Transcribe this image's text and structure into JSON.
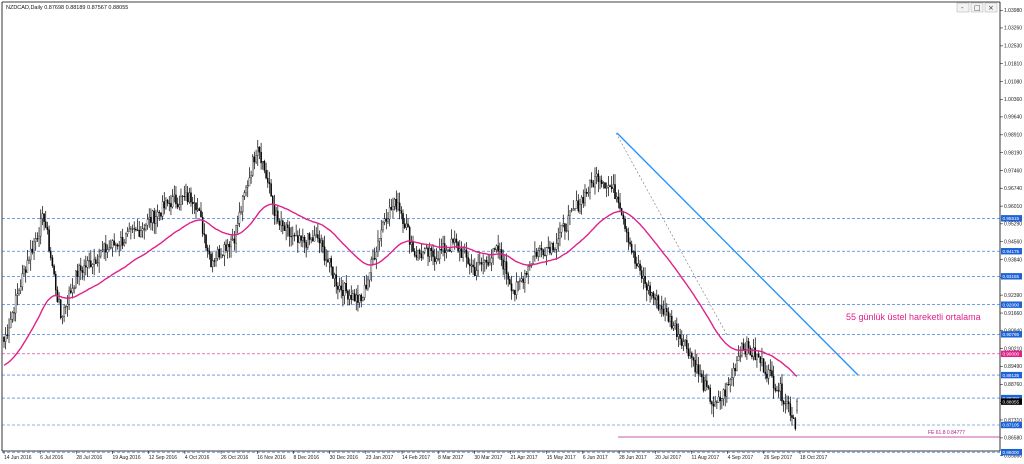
{
  "window": {
    "header_text": "NZDCAD,Daily  0.87698 0.88189 0.87567 0.88055",
    "buttons": [
      "-",
      "□",
      "×"
    ]
  },
  "chart_data": {
    "type": "candlestick",
    "symbol": "NZDCAD",
    "timeframe": "Daily",
    "ohlc": {
      "open": 0.87698,
      "high": 0.88189,
      "low": 0.87567,
      "close": 0.88055
    },
    "ylim": [
      0.8621,
      1.0399
    ],
    "price_ticks": [
      1.0398,
      1.0326,
      1.0253,
      1.0181,
      1.0108,
      1.0036,
      0.9964,
      0.9891,
      0.9819,
      0.9746,
      0.9674,
      0.9601,
      0.9529,
      0.9456,
      0.9384,
      0.9311,
      0.9239,
      0.9166,
      0.9094,
      0.9021,
      0.8949,
      0.8876,
      0.8803,
      0.8731,
      0.8658,
      0.8586
    ],
    "price_tick_labels": [
      "1.03980",
      "1.03260",
      "1.02530",
      "1.01810",
      "1.01080",
      "1.00360",
      "0.99640",
      "0.98910",
      "0.98190",
      "0.97460",
      "0.96740",
      "0.96010",
      "0.95290",
      "0.94560",
      "0.93840",
      "0.93110",
      "0.92390",
      "0.91660",
      "0.90940",
      "0.90210",
      "0.89490",
      "0.88760",
      "0.88030",
      "0.87310",
      "0.86580",
      "0.85860"
    ],
    "date_labels": [
      "14 Jun 2016",
      "6 Jul 2016",
      "28 Jul 2016",
      "19 Aug 2016",
      "12 Sep 2016",
      "4 Oct 2016",
      "26 Oct 2016",
      "16 Nov 2016",
      "8 Dec 2016",
      "30 Dec 2016",
      "23 Jan 2017",
      "14 Feb 2017",
      "8 Mar 2017",
      "30 Mar 2017",
      "21 Apr 2017",
      "15 May 2017",
      "6 Jun 2017",
      "28 Jun 2017",
      "20 Jul 2017",
      "11 Aug 2017",
      "4 Sep 2017",
      "26 Sep 2017",
      "18 Oct 2017"
    ],
    "levels": [
      {
        "label": "0.95515",
        "value": 0.95515,
        "color": "#1e63d6"
      },
      {
        "label": "0.94175",
        "value": 0.94175,
        "color": "#1e63d6"
      },
      {
        "label": "0.93155",
        "value": 0.93155,
        "color": "#1e63d6"
      },
      {
        "label": "0.92000",
        "value": 0.92,
        "color": "#1e63d6"
      },
      {
        "label": "0.90795",
        "value": 0.90795,
        "color": "#1e63d6"
      },
      {
        "label": "0.90000",
        "value": 0.9,
        "color": "#e0218a"
      },
      {
        "label": "0.89135",
        "value": 0.89135,
        "color": "#1e63d6"
      },
      {
        "label": "0.88200",
        "value": 0.882,
        "color": "#1e63d6"
      },
      {
        "label": "0.87105",
        "value": 0.87105,
        "color": "#1e63d6"
      },
      {
        "label": "0.86000",
        "value": 0.86,
        "color": "#1e63d6"
      }
    ],
    "current_price_label": "0.88055",
    "ema_label": "55 günlük üstel hareketli ortalama",
    "fibo_label": "FE  61.8  0.84777",
    "fibo_value": 0.84777,
    "colors": {
      "candles": "#000000",
      "ema": "#e0218a",
      "trendline": "#1e90ff",
      "levels": "#1e63d6",
      "fibo": "#b0208f"
    }
  }
}
